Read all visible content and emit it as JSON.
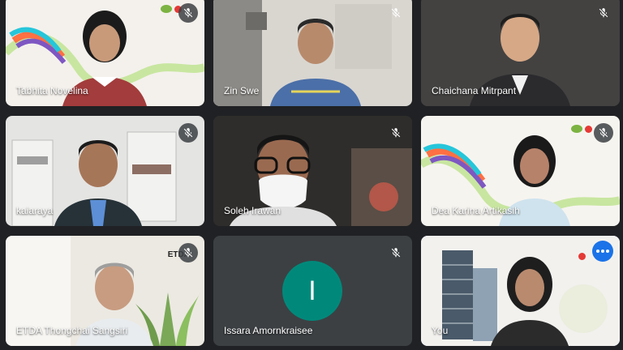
{
  "participants": [
    {
      "name": "Tabhita Novelina",
      "muted": true
    },
    {
      "name": "Zin Swe",
      "muted": true
    },
    {
      "name": "Chaichana Mitrpant",
      "muted": true
    },
    {
      "name": "kaiaraya",
      "muted": true
    },
    {
      "name": "Soleh Irawan",
      "muted": true
    },
    {
      "name": "Dea Karina Artikasih",
      "muted": true
    },
    {
      "name": "ETDA Thongchai Sangsiri",
      "muted": true,
      "logo_text": "ETDA"
    },
    {
      "name": "Issara Amornkraisee",
      "muted": true,
      "avatar_letter": "I",
      "avatar_color": "#00897b"
    },
    {
      "name": "You",
      "muted": false
    }
  ],
  "icons": {
    "mute": "mic-off-icon",
    "more": "more-options-icon"
  },
  "colors": {
    "background": "#202124",
    "tile": "#3c4043",
    "self_outline": "#8ab4f8",
    "more_button": "#1a73e8"
  }
}
